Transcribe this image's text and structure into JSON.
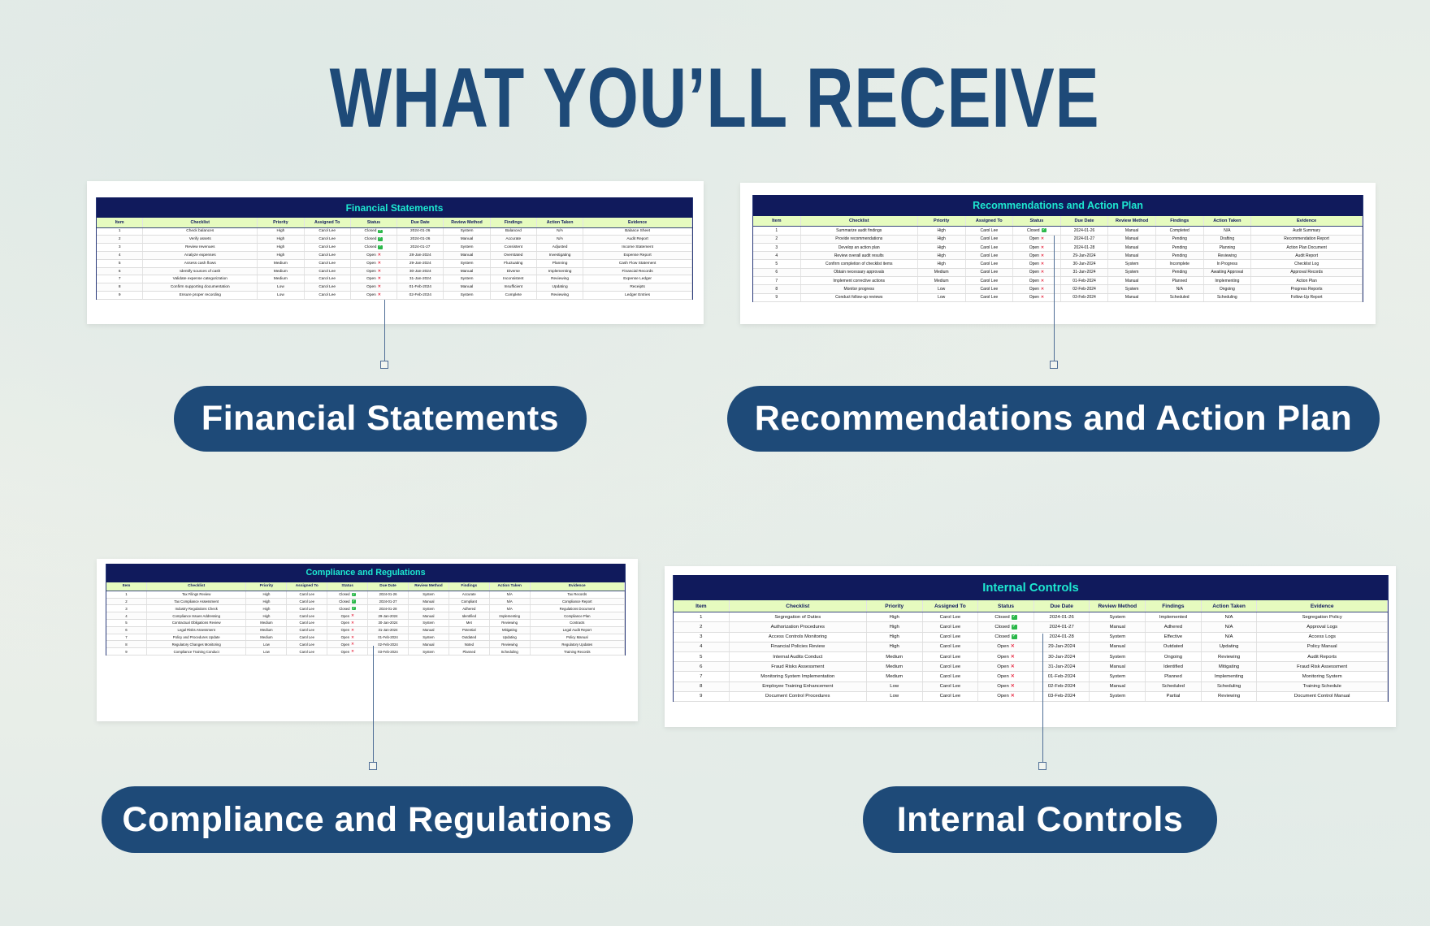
{
  "title": "WHAT YOU’LL RECEIVE",
  "columns": [
    "Item",
    "Checklist",
    "Priority",
    "Assigned To",
    "Status",
    "Due Date",
    "Review Method",
    "Findings",
    "Action Taken",
    "Evidence"
  ],
  "colors": {
    "title": "#1e4a78",
    "pill": "#1e4a78",
    "table_title_bg": "#101a5c",
    "table_title_text": "#1de8d0",
    "header_bg": "#e6fbbf",
    "closed_icon": "#2bb84a",
    "open_icon": "#e8334a"
  },
  "status_icons": {
    "Closed": "check-box-icon",
    "Open": "x-mark-icon"
  },
  "sections": [
    {
      "label": "Financial Statements",
      "table_title": "Financial Statements",
      "rows": [
        [
          "1",
          "Check balances",
          "High",
          "Carol Lee",
          "Closed",
          "2024-01-26",
          "System",
          "Balanced",
          "N/A",
          "Balance Sheet"
        ],
        [
          "2",
          "Verify assets",
          "High",
          "Carol Lee",
          "Closed",
          "2024-01-26",
          "Manual",
          "Accurate",
          "N/A",
          "Audit Report"
        ],
        [
          "3",
          "Review revenues",
          "High",
          "Carol Lee",
          "Closed",
          "2024-01-27",
          "System",
          "Consistent",
          "Adjusted",
          "Income Statement"
        ],
        [
          "4",
          "Analyze expenses",
          "High",
          "Carol Lee",
          "Open",
          "28-Jan-2024",
          "Manual",
          "Overstated",
          "Investigating",
          "Expense Report"
        ],
        [
          "5",
          "Assess cash flows",
          "Medium",
          "Carol Lee",
          "Open",
          "29-Jan-2024",
          "System",
          "Fluctuating",
          "Planning",
          "Cash Flow Statement"
        ],
        [
          "6",
          "Identify sources of cash",
          "Medium",
          "Carol Lee",
          "Open",
          "30-Jan-2024",
          "Manual",
          "Diverse",
          "Implementing",
          "Financial Records"
        ],
        [
          "7",
          "Validate expense categorization",
          "Medium",
          "Carol Lee",
          "Open",
          "31-Jan-2024",
          "System",
          "Inconsistent",
          "Reviewing",
          "Expense Ledger"
        ],
        [
          "8",
          "Confirm supporting documentation",
          "Low",
          "Carol Lee",
          "Open",
          "01-Feb-2024",
          "Manual",
          "Insufficient",
          "Updating",
          "Receipts"
        ],
        [
          "9",
          "Ensure proper recording",
          "Low",
          "Carol Lee",
          "Open",
          "02-Feb-2024",
          "System",
          "Complete",
          "Reviewing",
          "Ledger Entries"
        ]
      ]
    },
    {
      "label": "Recommendations and Action Plan",
      "table_title": "Recommendations and Action Plan",
      "rows": [
        [
          "1",
          "Summarize audit findings",
          "High",
          "Carol Lee",
          "Closed",
          "2024-01-26",
          "Manual",
          "Completed",
          "N/A",
          "Audit Summary"
        ],
        [
          "2",
          "Provide recommendations",
          "High",
          "Carol Lee",
          "Open",
          "2024-01-27",
          "Manual",
          "Pending",
          "Drafting",
          "Recommendation Report"
        ],
        [
          "3",
          "Develop an action plan",
          "High",
          "Carol Lee",
          "Open",
          "2024-01-28",
          "Manual",
          "Pending",
          "Planning",
          "Action Plan Document"
        ],
        [
          "4",
          "Review overall audit results",
          "High",
          "Carol Lee",
          "Open",
          "29-Jan-2024",
          "Manual",
          "Pending",
          "Reviewing",
          "Audit Report"
        ],
        [
          "5",
          "Confirm completion of checklist items",
          "High",
          "Carol Lee",
          "Open",
          "30-Jan-2024",
          "System",
          "Incomplete",
          "In Progress",
          "Checklist Log"
        ],
        [
          "6",
          "Obtain necessary approvals",
          "Medium",
          "Carol Lee",
          "Open",
          "31-Jan-2024",
          "System",
          "Pending",
          "Awaiting Approval",
          "Approval Records"
        ],
        [
          "7",
          "Implement corrective actions",
          "Medium",
          "Carol Lee",
          "Open",
          "01-Feb-2024",
          "Manual",
          "Planned",
          "Implementing",
          "Action Plan"
        ],
        [
          "8",
          "Monitor progress",
          "Low",
          "Carol Lee",
          "Open",
          "02-Feb-2024",
          "System",
          "N/A",
          "Ongoing",
          "Progress Reports"
        ],
        [
          "9",
          "Conduct follow-up reviews",
          "Low",
          "Carol Lee",
          "Open",
          "03-Feb-2024",
          "Manual",
          "Scheduled",
          "Scheduling",
          "Follow-Up Report"
        ]
      ]
    },
    {
      "label": "Compliance and Regulations",
      "table_title": "Compliance and Regulations",
      "rows": [
        [
          "1",
          "Tax Filings Review",
          "High",
          "Carol Lee",
          "Closed",
          "2024-01-26",
          "System",
          "Accurate",
          "N/A",
          "Tax Records"
        ],
        [
          "2",
          "Tax Compliance Assessment",
          "High",
          "Carol Lee",
          "Closed",
          "2024-01-27",
          "Manual",
          "Compliant",
          "N/A",
          "Compliance Report"
        ],
        [
          "3",
          "Industry Regulations Check",
          "High",
          "Carol Lee",
          "Closed",
          "2024-01-28",
          "System",
          "Adhered",
          "N/A",
          "Regulations Document"
        ],
        [
          "4",
          "Compliance Issues Addressing",
          "High",
          "Carol Lee",
          "Open",
          "29-Jan-2024",
          "Manual",
          "Identified",
          "Implementing",
          "Compliance Plan"
        ],
        [
          "5",
          "Contractual Obligations Review",
          "Medium",
          "Carol Lee",
          "Open",
          "30-Jan-2024",
          "System",
          "Met",
          "Reviewing",
          "Contracts"
        ],
        [
          "6",
          "Legal Risks Assessment",
          "Medium",
          "Carol Lee",
          "Open",
          "31-Jan-2024",
          "Manual",
          "Potential",
          "Mitigating",
          "Legal Audit Report"
        ],
        [
          "7",
          "Policy and Procedures Update",
          "Medium",
          "Carol Lee",
          "Open",
          "01-Feb-2024",
          "System",
          "Outdated",
          "Updating",
          "Policy Manual"
        ],
        [
          "8",
          "Regulatory Changes Monitoring",
          "Low",
          "Carol Lee",
          "Open",
          "02-Feb-2024",
          "Manual",
          "Noted",
          "Reviewing",
          "Regulatory Updates"
        ],
        [
          "9",
          "Compliance Training Conduct",
          "Low",
          "Carol Lee",
          "Open",
          "03-Feb-2024",
          "System",
          "Planned",
          "Scheduling",
          "Training Records"
        ]
      ]
    },
    {
      "label": "Internal Controls",
      "table_title": "Internal Controls",
      "rows": [
        [
          "1",
          "Segregation of Duties",
          "High",
          "Carol Lee",
          "Closed",
          "2024-01-26",
          "System",
          "Implemented",
          "N/A",
          "Segregation Policy"
        ],
        [
          "2",
          "Authorization Procedures",
          "High",
          "Carol Lee",
          "Closed",
          "2024-01-27",
          "Manual",
          "Adhered",
          "N/A",
          "Approval Logs"
        ],
        [
          "3",
          "Access Controls Monitoring",
          "High",
          "Carol Lee",
          "Closed",
          "2024-01-28",
          "System",
          "Effective",
          "N/A",
          "Access Logs"
        ],
        [
          "4",
          "Financial Policies Review",
          "High",
          "Carol Lee",
          "Open",
          "29-Jan-2024",
          "Manual",
          "Outdated",
          "Updating",
          "Policy Manual"
        ],
        [
          "5",
          "Internal Audits Conduct",
          "Medium",
          "Carol Lee",
          "Open",
          "30-Jan-2024",
          "System",
          "Ongoing",
          "Reviewing",
          "Audit Reports"
        ],
        [
          "6",
          "Fraud Risks Assessment",
          "Medium",
          "Carol Lee",
          "Open",
          "31-Jan-2024",
          "Manual",
          "Identified",
          "Mitigating",
          "Fraud Risk Assessment"
        ],
        [
          "7",
          "Monitoring System Implementation",
          "Medium",
          "Carol Lee",
          "Open",
          "01-Feb-2024",
          "System",
          "Planned",
          "Implementing",
          "Monitoring System"
        ],
        [
          "8",
          "Employee Training Enhancement",
          "Low",
          "Carol Lee",
          "Open",
          "02-Feb-2024",
          "Manual",
          "Scheduled",
          "Scheduling",
          "Training Schedule"
        ],
        [
          "9",
          "Document Control Procedures",
          "Low",
          "Carol Lee",
          "Open",
          "03-Feb-2024",
          "System",
          "Partial",
          "Reviewing",
          "Document Control Manual"
        ]
      ]
    }
  ]
}
